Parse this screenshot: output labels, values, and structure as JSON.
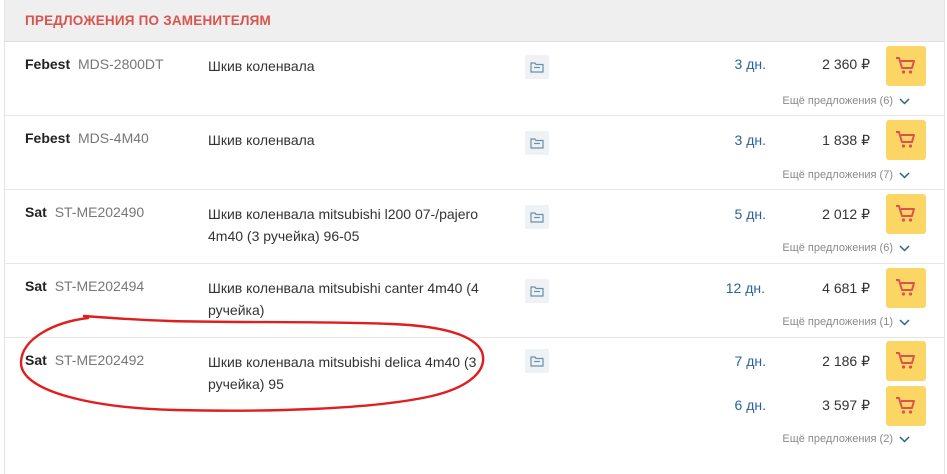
{
  "header": {
    "title": "ПРЕДЛОЖЕНИЯ ПО ЗАМЕНИТЕЛЯМ"
  },
  "colors": {
    "accent": "#d9534f",
    "cart": "#fcd664",
    "link": "#2a6496",
    "annotation": "#e01e1e"
  },
  "icons": {
    "doc": "folder-doc-icon",
    "cart": "cart-icon",
    "chevron": "chevron-down-icon"
  },
  "rows": [
    {
      "brand": "Febest",
      "code": "MDS-2800DT",
      "desc": "Шкив коленвала",
      "offers": [
        {
          "days": "3 дн.",
          "price": "2 360 ₽"
        }
      ],
      "more": "Ещё предложения (6)"
    },
    {
      "brand": "Febest",
      "code": "MDS-4M40",
      "desc": "Шкив коленвала",
      "offers": [
        {
          "days": "3 дн.",
          "price": "1 838 ₽"
        }
      ],
      "more": "Ещё предложения (7)"
    },
    {
      "brand": "Sat",
      "code": "ST-ME202490",
      "desc": "Шкив коленвала mitsubishi l200 07-/pajero 4m40 (3 ручейка) 96-05",
      "offers": [
        {
          "days": "5 дн.",
          "price": "2 012 ₽"
        }
      ],
      "more": "Ещё предложения (6)"
    },
    {
      "brand": "Sat",
      "code": "ST-ME202494",
      "desc": "Шкив коленвала mitsubishi canter 4m40 (4 ручейка)",
      "offers": [
        {
          "days": "12 дн.",
          "price": "4 681 ₽"
        }
      ],
      "more": "Ещё предложения (1)"
    },
    {
      "brand": "Sat",
      "code": "ST-ME202492",
      "desc": "Шкив коленвала mitsubishi delica 4m40 (3 ручейка) 95",
      "offers": [
        {
          "days": "7 дн.",
          "price": "2 186 ₽"
        },
        {
          "days": "6 дн.",
          "price": "3 597 ₽"
        }
      ],
      "more": "Ещё предложения (2)"
    }
  ]
}
